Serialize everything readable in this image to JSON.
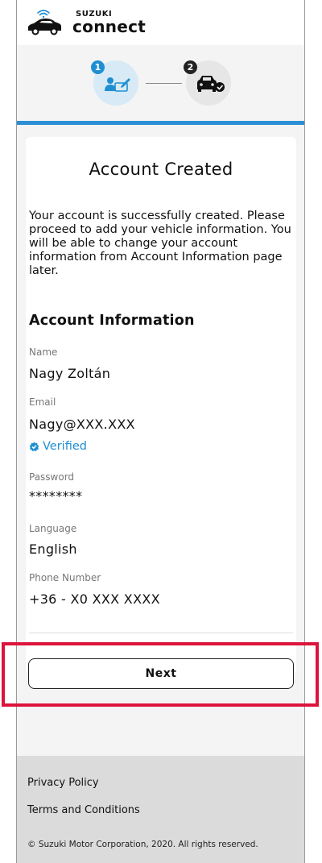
{
  "brand": {
    "top": "SUZUKI",
    "bottom": "connect"
  },
  "stepper": {
    "step1_number": "1",
    "step2_number": "2"
  },
  "card": {
    "title": "Account Created",
    "intro": "Your account is successfully created. Please proceed to add your vehicle information. You will be able to change your account information from Account Information page later.",
    "section_title": "Account Information",
    "fields": {
      "name_label": "Name",
      "name_value": "Nagy Zoltán",
      "email_label": "Email",
      "email_value": "Nagy@XXX.XXX",
      "verified_label": "Verified",
      "password_label": "Password",
      "password_value": "********",
      "language_label": "Language",
      "language_value": "English",
      "phone_label": "Phone Number",
      "phone_value": "+36 - X0 XXX XXXX"
    }
  },
  "next_label": "Next",
  "footer": {
    "privacy": "Privacy Policy",
    "terms": "Terms and Conditions",
    "copyright": "© Suzuki Motor Corporation, 2020. All rights reserved."
  },
  "colors": {
    "accent": "#2c8fd6",
    "highlight": "#dc143c",
    "footer_bg": "#dbdbdb"
  },
  "icons": [
    "wifi-icon",
    "car-icon",
    "account-edit-icon",
    "car-check-icon",
    "verified-check-icon"
  ]
}
